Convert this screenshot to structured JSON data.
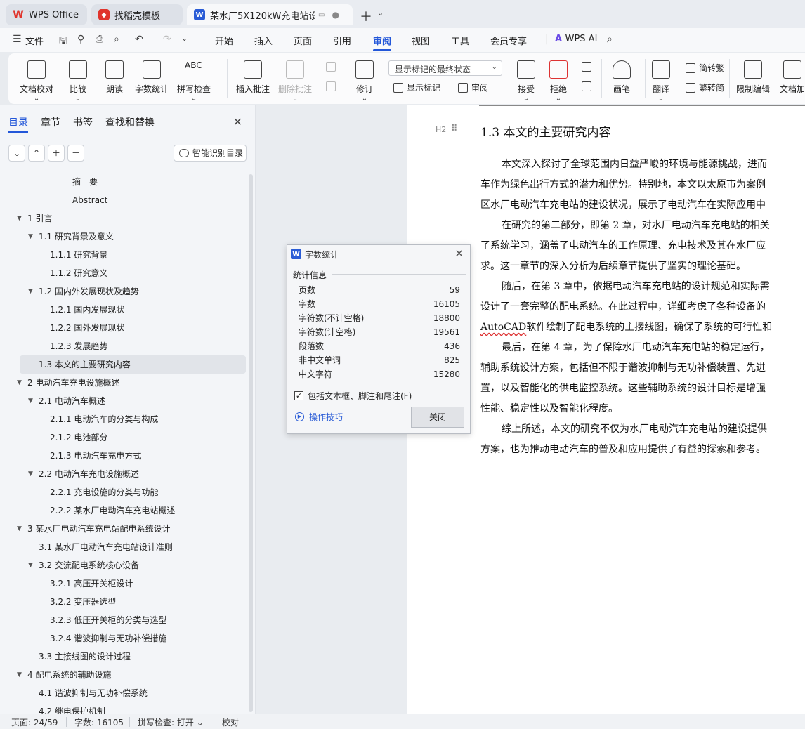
{
  "tabs": [
    {
      "label": "WPS Office",
      "icon": "wps-logo-icon",
      "color": "#e0342c"
    },
    {
      "label": "找稻壳模板",
      "icon": "docer-icon",
      "color": "#e0342c"
    },
    {
      "label": "某水厂5X120kW充电站设计",
      "icon": "word-doc-icon",
      "color": "#2a5cd6"
    }
  ],
  "menu": {
    "file": "文件",
    "items": [
      "开始",
      "插入",
      "页面",
      "引用",
      "审阅",
      "视图",
      "工具",
      "会员专享"
    ],
    "active": "审阅",
    "ai": "WPS AI"
  },
  "ribbon": {
    "proof": "文档校对",
    "compare": "比较",
    "read": "朗读",
    "wordcount": "字数统计",
    "spellcheck": "拼写检查",
    "insert_comment": "插入批注",
    "delete_comment": "删除批注",
    "track": "修订",
    "markup_select": "显示标记的最终状态",
    "show_markup": "显示标记",
    "review": "审阅",
    "accept": "接受",
    "reject": "拒绝",
    "pen": "画笔",
    "translate": "翻译",
    "to_trad": "简转繁",
    "to_simp": "繁转简",
    "restrict": "限制编辑",
    "doc_enc": "文档加"
  },
  "nav": {
    "tabs": [
      "目录",
      "章节",
      "书签",
      "查找和替换"
    ],
    "smart": "智能识别目录",
    "toc": [
      {
        "label": "摘　要",
        "level": 0
      },
      {
        "label": "Abstract",
        "level": 0
      },
      {
        "label": "1  引言",
        "level": 1
      },
      {
        "label": "1.1  研究背景及意义",
        "level": 2
      },
      {
        "label": "1.1.1  研究背景",
        "level": 3
      },
      {
        "label": "1.1.2  研究意义",
        "level": 3
      },
      {
        "label": "1.2  国内外发展现状及趋势",
        "level": 2
      },
      {
        "label": "1.2.1  国内发展现状",
        "level": 3
      },
      {
        "label": "1.2.2  国外发展现状",
        "level": 3
      },
      {
        "label": "1.2.3  发展趋势",
        "level": 3
      },
      {
        "label": "1.3 本文的主要研究内容",
        "level": 2
      },
      {
        "label": "2  电动汽车充电设施概述",
        "level": 1
      },
      {
        "label": "2.1  电动汽车概述",
        "level": 2
      },
      {
        "label": "2.1.1  电动汽车的分类与构成",
        "level": 3
      },
      {
        "label": "2.1.2  电池部分",
        "level": 3
      },
      {
        "label": "2.1.3  电动汽车充电方式",
        "level": 3
      },
      {
        "label": "2.2  电动汽车充电设施概述",
        "level": 2
      },
      {
        "label": "2.2.1  充电设施的分类与功能",
        "level": 3
      },
      {
        "label": "2.2.2  某水厂电动汽车充电站概述",
        "level": 3
      },
      {
        "label": "3  某水厂电动汽车充电站配电系统设计",
        "level": 1
      },
      {
        "label": "3.1  某水厂电动汽车充电站设计准则",
        "level": 2
      },
      {
        "label": "3.2  交流配电系统核心设备",
        "level": 2
      },
      {
        "label": "3.2.1  高压开关柜设计",
        "level": 3
      },
      {
        "label": "3.2.2  变压器选型",
        "level": 3
      },
      {
        "label": "3.2.3  低压开关柜的分类与选型",
        "level": 3
      },
      {
        "label": "3.2.4  谐波抑制与无功补偿措施",
        "level": 3
      },
      {
        "label": "3.3  主接线图的设计过程",
        "level": 2
      },
      {
        "label": "4  配电系统的辅助设施",
        "level": 1
      },
      {
        "label": "4.1  谐波抑制与无功补偿系统",
        "level": 2
      },
      {
        "label": "4.2  继电保护机制",
        "level": 2
      }
    ]
  },
  "document": {
    "heading_tag": "H2",
    "heading": "1.3 本文的主要研究内容",
    "lines": [
      {
        "text": "本文深入探讨了全球范围内日益严峻的环境与能源挑战，进而",
        "indent": true
      },
      {
        "text": "车作为绿色出行方式的潜力和优势。特别地，本文以太原市为案例",
        "indent": false
      },
      {
        "text": "区水厂电动汽车充电站的建设状况，展示了电动汽车在实际应用中",
        "indent": false
      },
      {
        "text": "在研究的第二部分，即第 2 章，对水厂电动汽车充电站的相关",
        "indent": true
      },
      {
        "text": "了系统学习，涵盖了电动汽车的工作原理、充电技术及其在水厂应",
        "indent": false
      },
      {
        "text": "求。这一章节的深入分析为后续章节提供了坚实的理论基础。",
        "indent": false
      },
      {
        "text": "随后，在第 3 章中，依据电动汽车充电站的设计规范和实际需",
        "indent": true
      },
      {
        "text": "设计了一套完整的配电系统。在此过程中，详细考虑了各种设备的",
        "indent": false
      },
      {
        "text": "软件绘制了配电系统的主接线图，确保了系统的可行性和",
        "indent": false,
        "prefix": "AutoCAD"
      },
      {
        "text": "最后，在第 4 章，为了保障水厂电动汽车充电站的稳定运行，",
        "indent": true
      },
      {
        "text": "辅助系统设计方案，包括但不限于谐波抑制与无功补偿装置、先进",
        "indent": false
      },
      {
        "text": "置，以及智能化的供电监控系统。这些辅助系统的设计目标是增强",
        "indent": false
      },
      {
        "text": "性能、稳定性以及智能化程度。",
        "indent": false
      },
      {
        "text": "综上所述，本文的研究不仅为水厂电动汽车充电站的建设提供",
        "indent": true
      },
      {
        "text": "方案，也为推动电动汽车的普及和应用提供了有益的探索和参考。",
        "indent": false
      }
    ]
  },
  "dialog": {
    "title": "字数统计",
    "group": "统计信息",
    "stats": [
      {
        "label": "页数",
        "value": "59"
      },
      {
        "label": "字数",
        "value": "16105"
      },
      {
        "label": "字符数(不计空格)",
        "value": "18800"
      },
      {
        "label": "字符数(计空格)",
        "value": "19561"
      },
      {
        "label": "段落数",
        "value": "436"
      },
      {
        "label": "非中文单词",
        "value": "825"
      },
      {
        "label": "中文字符",
        "value": "15280"
      }
    ],
    "checkbox": "包括文本框、脚注和尾注(F)",
    "checked": true,
    "tips": "操作技巧",
    "close": "关闭"
  },
  "status": {
    "page": "页面: 24/59",
    "words": "字数: 16105",
    "spell": "拼写检查: 打开",
    "proof": "校对"
  }
}
